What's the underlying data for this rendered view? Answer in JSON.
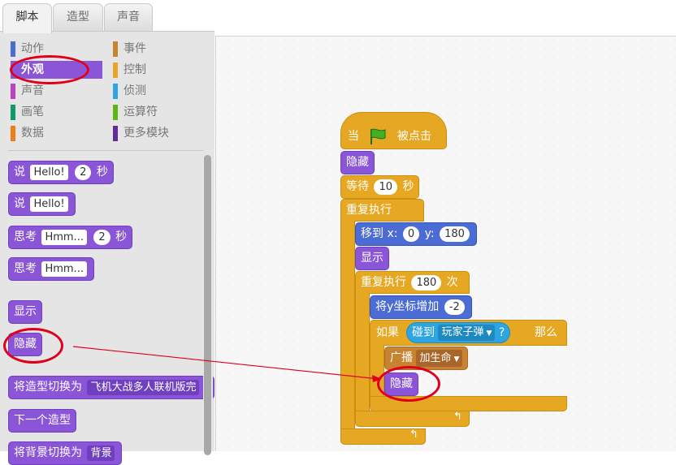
{
  "tabs": [
    "脚本",
    "造型",
    "声音"
  ],
  "categories": {
    "left": [
      {
        "label": "动作",
        "color": "#4a6cd4"
      },
      {
        "label": "外观",
        "color": "#8a55d7"
      },
      {
        "label": "声音",
        "color": "#bb42c3"
      },
      {
        "label": "画笔",
        "color": "#0e9a6c"
      },
      {
        "label": "数据",
        "color": "#ee7d16"
      }
    ],
    "right": [
      {
        "label": "事件",
        "color": "#c88330"
      },
      {
        "label": "控制",
        "color": "#e6a822"
      },
      {
        "label": "侦测",
        "color": "#2ca5e2"
      },
      {
        "label": "运算符",
        "color": "#5cb712"
      },
      {
        "label": "更多模块",
        "color": "#632d99"
      }
    ],
    "selected": "外观"
  },
  "palette": {
    "say_secs": {
      "say": "说",
      "msg": "Hello!",
      "secs": "2",
      "unit": "秒"
    },
    "say": {
      "say": "说",
      "msg": "Hello!"
    },
    "think_secs": {
      "think": "思考",
      "msg": "Hmm...",
      "secs": "2",
      "unit": "秒"
    },
    "think": {
      "think": "思考",
      "msg": "Hmm..."
    },
    "show": "显示",
    "hide": "隐藏",
    "switch_costume": {
      "label": "将造型切换为",
      "value": "飞机大战多人联机版完"
    },
    "next_costume": "下一个造型",
    "switch_backdrop": {
      "label": "将背景切换为",
      "value": "背景"
    }
  },
  "script": {
    "hat": {
      "when": "当",
      "clicked": "被点击"
    },
    "hide": "隐藏",
    "wait": {
      "label": "等待",
      "value": "10",
      "unit": "秒"
    },
    "forever": "重复执行",
    "goto": {
      "label": "移到",
      "x_label": "x:",
      "x": "0",
      "y_label": "y:",
      "y": "180"
    },
    "show": "显示",
    "repeat": {
      "label": "重复执行",
      "value": "180",
      "unit": "次"
    },
    "change_y": {
      "label": "将y坐标增加",
      "value": "-2"
    },
    "if": {
      "label": "如果",
      "then": "那么"
    },
    "touching": {
      "label": "碰到",
      "value": "玩家子弹",
      "q": "?"
    },
    "broadcast": {
      "label": "广播",
      "value": "加生命"
    },
    "hide2": "隐藏",
    "loop_arrow": "↰"
  },
  "annotation_color": "#e0001a"
}
